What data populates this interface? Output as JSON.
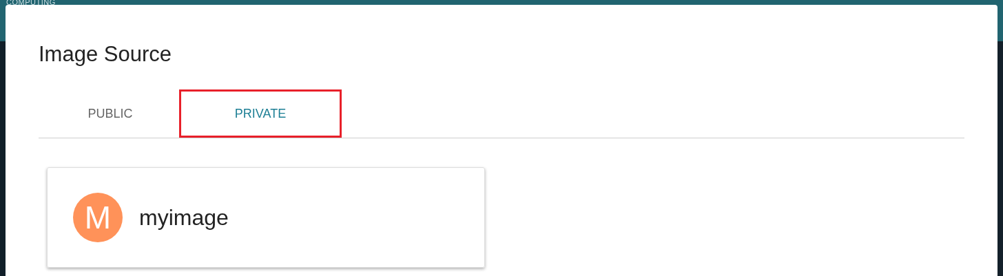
{
  "background": {
    "brand": "COMPUTING"
  },
  "dialog": {
    "title": "Image Source",
    "tabs": [
      {
        "label": "PUBLIC",
        "selected": false,
        "highlighted": false
      },
      {
        "label": "PRIVATE",
        "selected": true,
        "highlighted": true
      }
    ],
    "images": [
      {
        "initial": "M",
        "name": "myimage",
        "color": "#ff9259"
      }
    ]
  }
}
